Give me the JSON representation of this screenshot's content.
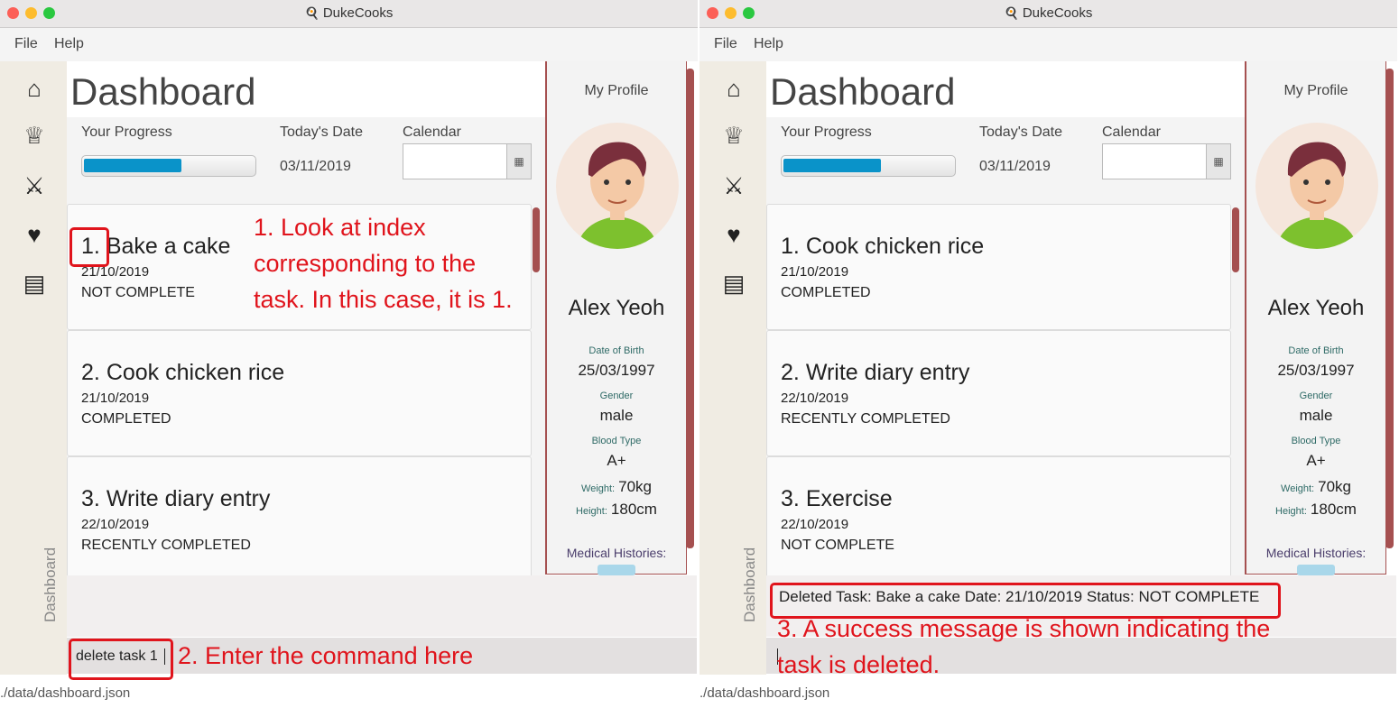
{
  "app_title": "DukeCooks",
  "menu": [
    "File",
    "Help"
  ],
  "sidebar_label": "Dashboard",
  "status_path": "./data/dashboard.json",
  "dashboard": {
    "title": "Dashboard",
    "progress_label": "Your Progress",
    "progress_value": 0.58,
    "date_label": "Today's Date",
    "date_value": "03/11/2019",
    "calendar_label": "Calendar",
    "calendar_icon": "calendar-icon"
  },
  "profile": {
    "title": "My Profile",
    "name": "Alex Yeoh",
    "dob_label": "Date of Birth",
    "dob": "25/03/1997",
    "gender_label": "Gender",
    "gender": "male",
    "blood_label": "Blood Type",
    "blood": "A+",
    "weight_label": "Weight:",
    "weight": "70kg",
    "height_label": "Height:",
    "height": "180cm",
    "medical_label": "Medical Histories:"
  },
  "left": {
    "tasks": [
      {
        "index": "1.",
        "name": "Bake a cake",
        "date": "21/10/2019",
        "status": "NOT COMPLETE"
      },
      {
        "index": "2.",
        "name": "Cook chicken rice",
        "date": "21/10/2019",
        "status": "COMPLETED"
      },
      {
        "index": "3.",
        "name": "Write diary entry",
        "date": "22/10/2019",
        "status": "RECENTLY COMPLETED"
      }
    ],
    "result_text": "",
    "command_text": "delete task 1",
    "annotation_1": [
      "1. Look at index",
      "corresponding to the",
      "task. In this case, it is 1."
    ],
    "annotation_2": "2. Enter the command here"
  },
  "right": {
    "tasks": [
      {
        "index": "1.",
        "name": "Cook chicken rice",
        "date": "21/10/2019",
        "status": "COMPLETED"
      },
      {
        "index": "2.",
        "name": "Write diary entry",
        "date": "22/10/2019",
        "status": "RECENTLY COMPLETED"
      },
      {
        "index": "3.",
        "name": "Exercise",
        "date": "22/10/2019",
        "status": "NOT COMPLETE"
      }
    ],
    "result_text": "Deleted Task: Bake a cake Date: 21/10/2019 Status: NOT COMPLETE",
    "command_text": "",
    "annotation_3": [
      "3. A success message is shown indicating the",
      "task is deleted."
    ]
  },
  "icons": [
    "home-icon",
    "chef-hat-icon",
    "dumbbell-icon",
    "heartbeat-icon",
    "diary-book-icon"
  ],
  "colors": {
    "accent": "#a55050",
    "progress": "#0a93c9",
    "annotation": "#e0141c"
  }
}
